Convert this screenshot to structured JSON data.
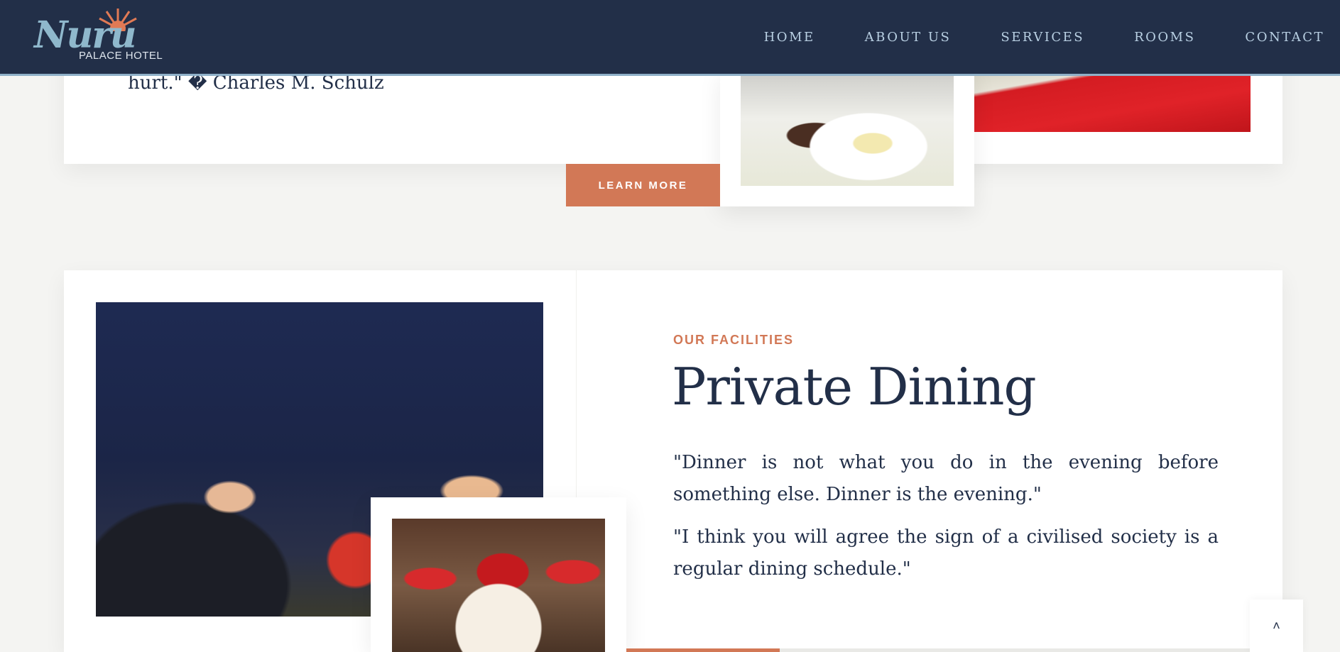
{
  "brand": {
    "logo_script": "Nuru",
    "logo_subtitle": "PALACE HOTEL",
    "logo_icon": "sun-icon"
  },
  "nav": {
    "items": [
      {
        "label": "HOME"
      },
      {
        "label": "ABOUT US"
      },
      {
        "label": "SERVICES"
      },
      {
        "label": "ROOMS"
      },
      {
        "label": "CONTACT"
      }
    ]
  },
  "section1": {
    "quote_tail": "hurt.\" � Charles M. Schulz",
    "learn_more_label": "LEARN MORE"
  },
  "section2": {
    "kicker": "OUR FACILITIES",
    "title": "Private Dining",
    "paragraphs": [
      "\"Dinner is not what you do in the evening before something else. Dinner is the evening.\"",
      "\"I think you will agree the sign of a civilised society is a regular dining schedule.\""
    ]
  },
  "scroll_top": {
    "icon": "chevron-up-icon",
    "glyph": "˄"
  },
  "colors": {
    "header_bg": "#222f48",
    "nav_text": "#b9d0e3",
    "accent": "#d27856",
    "text": "#222f48"
  }
}
